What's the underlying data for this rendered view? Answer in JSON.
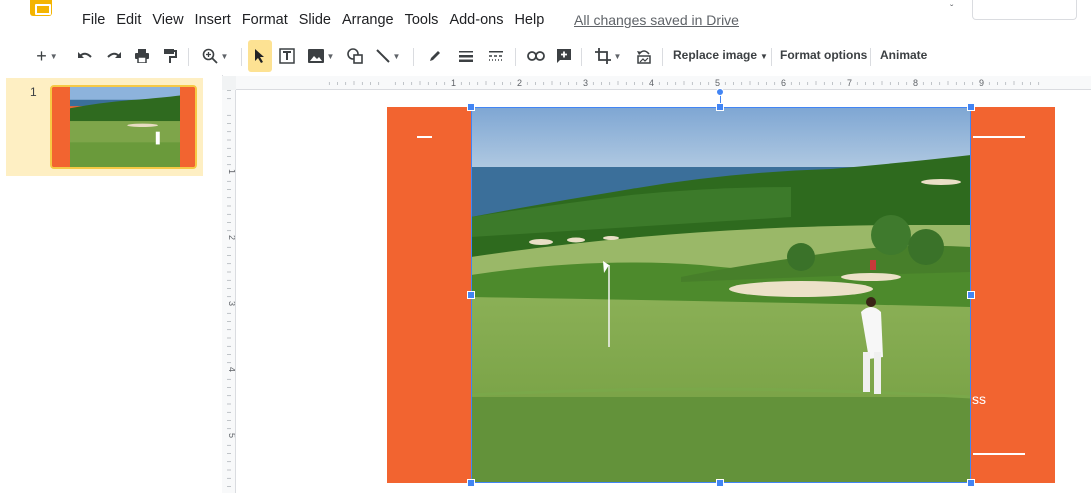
{
  "menu": {
    "items": [
      "File",
      "Edit",
      "View",
      "Insert",
      "Format",
      "Slide",
      "Arrange",
      "Tools",
      "Add-ons",
      "Help"
    ],
    "save_status": "All changes saved in Drive"
  },
  "toolbar": {
    "replace_image": "Replace image",
    "format_options": "Format options",
    "animate": "Animate"
  },
  "filmstrip": {
    "slides": [
      {
        "number": "1"
      }
    ]
  },
  "ruler": {
    "top_numbers": [
      "1",
      "2",
      "3",
      "4",
      "5",
      "6",
      "7",
      "8",
      "9"
    ],
    "left_numbers": [
      "1",
      "2",
      "3",
      "4",
      "5"
    ]
  },
  "slide": {
    "partial_text": "ss"
  },
  "colors": {
    "accent_orange": "#f26430",
    "selection_blue": "#4285f4",
    "filmstrip_selected": "#feefc3",
    "logo_yellow": "#f4b400"
  }
}
